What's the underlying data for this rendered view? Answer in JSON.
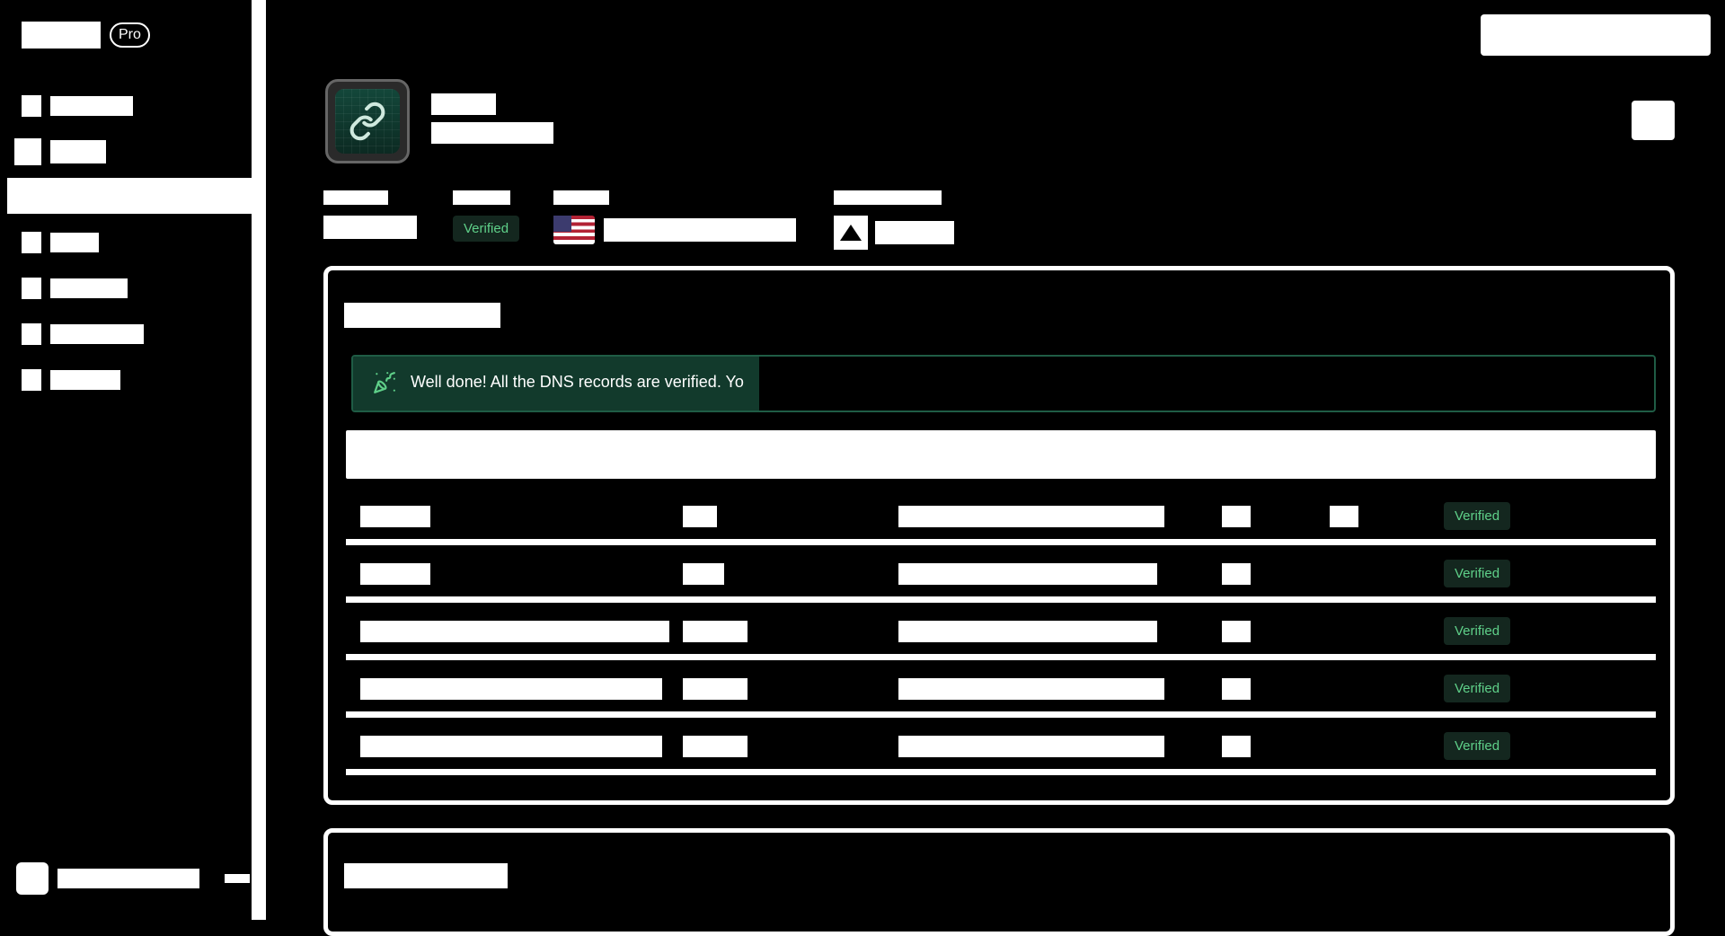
{
  "brand": {
    "plan_badge": "Pro"
  },
  "sidebar": {
    "items": [
      {
        "name": "sidebar-item-1",
        "icon": "square-icon"
      },
      {
        "name": "sidebar-item-2",
        "icon": "mail-icon"
      },
      {
        "name": "sidebar-item-3",
        "icon": "globe-icon",
        "active": true
      },
      {
        "name": "sidebar-item-4",
        "icon": "log-icon"
      },
      {
        "name": "sidebar-item-5",
        "icon": "key-icon"
      },
      {
        "name": "sidebar-item-6",
        "icon": "webhook-icon"
      },
      {
        "name": "sidebar-item-7",
        "icon": "gear-icon"
      }
    ]
  },
  "domain": {
    "status": "Verified",
    "region_flag": "us-flag-icon",
    "provider_icon": "vercel-icon"
  },
  "dns_panel": {
    "alert_text": "Well done! All the DNS records are verified. Yo",
    "alert_icon": "party-popper-icon",
    "rows": [
      {
        "status": "Verified"
      },
      {
        "status": "Verified"
      },
      {
        "status": "Verified"
      },
      {
        "status": "Verified"
      },
      {
        "status": "Verified"
      }
    ]
  },
  "colors": {
    "accent_green": "#5fd089",
    "badge_bg": "#14271f",
    "alert_bg": "#123a2c",
    "alert_border": "#1f5c45"
  }
}
